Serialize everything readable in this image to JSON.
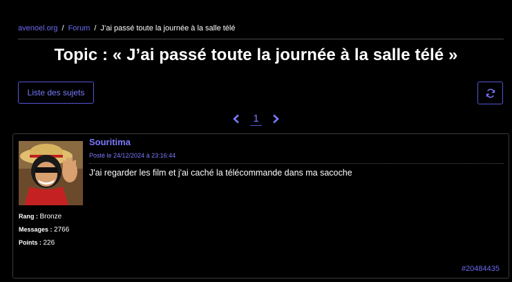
{
  "breadcrumb": {
    "site": "avenoel.org",
    "forum": "Forum",
    "current": "J’ai passé toute la journée à la salle télé",
    "separator": "/"
  },
  "title": "Topic : « J’ai passé toute la journée à la salle télé »",
  "toolbar": {
    "list_label": "Liste des sujets",
    "refresh_icon": "refresh-icon"
  },
  "pagination": {
    "current_page": "1",
    "prev_icon": "chevron-left-icon",
    "next_icon": "chevron-right-icon"
  },
  "post": {
    "author": "Souritima",
    "date": "Posté le 24/12/2024 à 23:16:44",
    "message": "J'ai regarder les film et j'ai caché la télécommande dans ma sacoche",
    "rank_label": "Rang : ",
    "rank_value": "Bronze",
    "messages_label": "Messages : ",
    "messages_value": "2766",
    "points_label": "Points : ",
    "points_value": "226",
    "id": "#20484435"
  },
  "colors": {
    "accent": "#6a6af0",
    "background": "#000000",
    "text": "#ffffff"
  }
}
